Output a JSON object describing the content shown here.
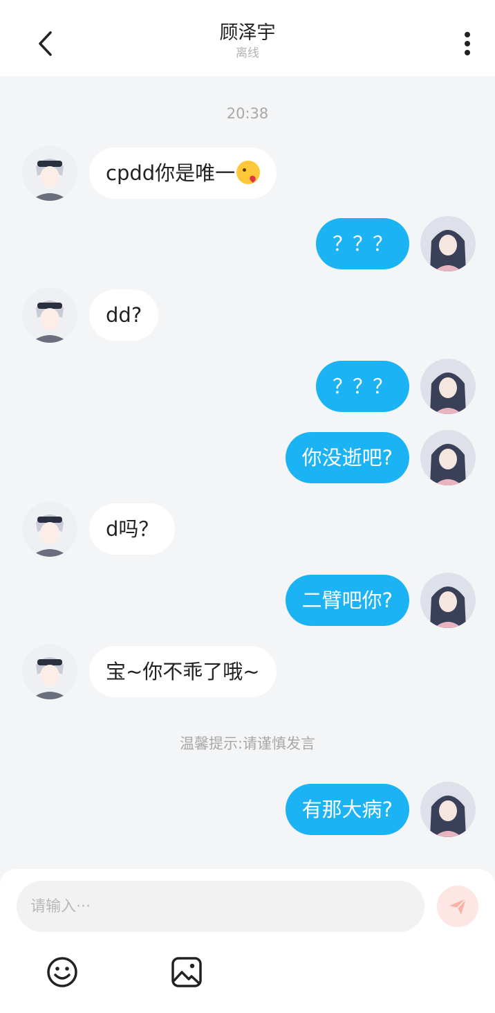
{
  "header": {
    "title": "顾泽宇",
    "status": "离线"
  },
  "chat": {
    "timestamp": "20:38",
    "tip": "温馨提示:请谨慎发言",
    "messages": [
      {
        "side": "in",
        "text": "cpdd你是唯一",
        "emoji": "kissing-heart"
      },
      {
        "side": "out",
        "text": "？？？"
      },
      {
        "side": "in",
        "text": "dd?"
      },
      {
        "side": "out",
        "text": "？？？"
      },
      {
        "side": "out",
        "text": "你没逝吧?"
      },
      {
        "side": "in",
        "text": "d吗？"
      },
      {
        "side": "out",
        "text": "二臂吧你?"
      },
      {
        "side": "in",
        "text": "宝~你不乖了哦~"
      },
      {
        "side": "out",
        "text": "有那大病?"
      }
    ]
  },
  "composer": {
    "placeholder": "请输入···",
    "value": ""
  },
  "icons": {
    "back": "chevron-left-icon",
    "more": "more-vertical-icon",
    "send": "paper-plane-icon",
    "emoji": "smiley-icon",
    "image": "image-icon"
  },
  "colors": {
    "accent": "#1cb3f5",
    "incoming_bubble": "#ffffff",
    "background": "#f4f5f7",
    "send_button": "#fde6e3"
  }
}
